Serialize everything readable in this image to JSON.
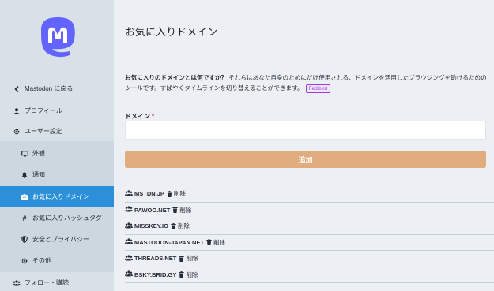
{
  "colors": {
    "sidebar_bg": "#d9e1e8",
    "active": "#2b90d9",
    "add_button": "#e2ad7e",
    "badge": "#9c3fd6",
    "logo": "#6364ff"
  },
  "sidebar": {
    "back_label": "Mastodon に戻る",
    "profile_label": "プロフィール",
    "user_settings_label": "ユーザー設定",
    "sub_items": [
      {
        "label": "外観",
        "icon": "desktop-icon"
      },
      {
        "label": "通知",
        "icon": "bell-icon"
      },
      {
        "label": "お気に入りドメイン",
        "icon": "users-icon",
        "active": true
      },
      {
        "label": "お気に入りハッシュタグ",
        "icon": "hashtag-icon"
      },
      {
        "label": "安全とプライバシー",
        "icon": "shield-icon"
      },
      {
        "label": "その他",
        "icon": "gear-icon"
      }
    ],
    "follow_label": "フォロー・購読"
  },
  "main": {
    "title": "お気に入りドメイン",
    "intro_bold": "お気に入りのドメインとは何ですか？",
    "intro_text": " それらはあなた自身のためにだけ使用される、ドメインを活用したブラウジングを助けるためのツールです。すばやくタイムラインを切り替えることができます。",
    "badge": "Fedibird",
    "domain_label": "ドメイン",
    "required_mark": "*",
    "domain_value": "",
    "add_button": "追加",
    "delete_label": "削除",
    "domains": [
      "MSTDN.JP",
      "PAWOO.NET",
      "MISSKEY.IO",
      "MASTODON-JAPAN.NET",
      "THREADS.NET",
      "BSKY.BRID.GY"
    ]
  }
}
